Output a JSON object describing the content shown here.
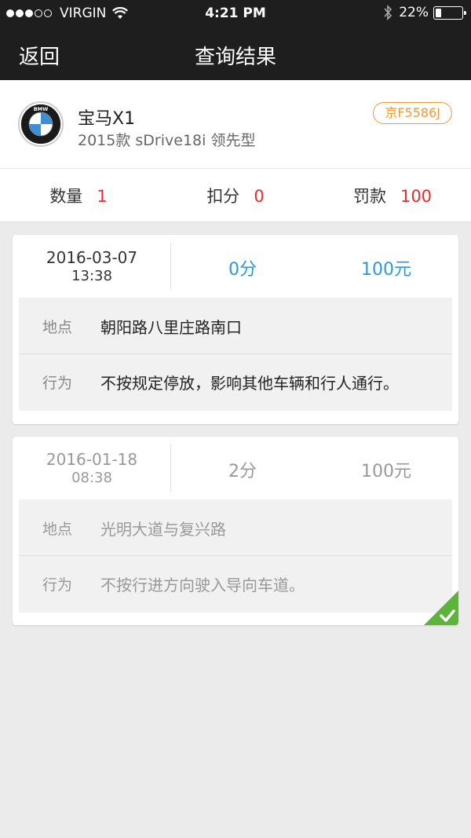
{
  "status_bar": {
    "carrier": "VIRGIN",
    "time": "4:21 PM",
    "battery": "22%",
    "battery_level": 0.22
  },
  "nav": {
    "back_label": "返回",
    "title": "查询结果"
  },
  "car": {
    "logo_icon": "bmw-logo-icon",
    "name": "宝马X1",
    "model": "2015款 sDrive18i 领先型",
    "plate": "京F5586J"
  },
  "summary": {
    "count_label": "数量",
    "count_value": "1",
    "points_label": "扣分",
    "points_value": "0",
    "fine_label": "罚款",
    "fine_value": "100"
  },
  "records": [
    {
      "date": "2016-03-07",
      "time": "13:38",
      "points": "0分",
      "fine": "100元",
      "location_label": "地点",
      "location": "朝阳路八里庄路南口",
      "behavior_label": "行为",
      "behavior": "不按规定停放，影响其他车辆和行人通行。",
      "handled": false
    },
    {
      "date": "2016-01-18",
      "time": "08:38",
      "points": "2分",
      "fine": "100元",
      "location_label": "地点",
      "location": "光明大道与复兴路",
      "behavior_label": "行为",
      "behavior": "不按行进方向驶入导向车道。",
      "handled": true
    }
  ],
  "colors": {
    "accent_blue": "#2a9bd8",
    "alert_red": "#e82c2c",
    "plate_orange": "#f09a3a",
    "handled_green": "#5cb53a"
  }
}
